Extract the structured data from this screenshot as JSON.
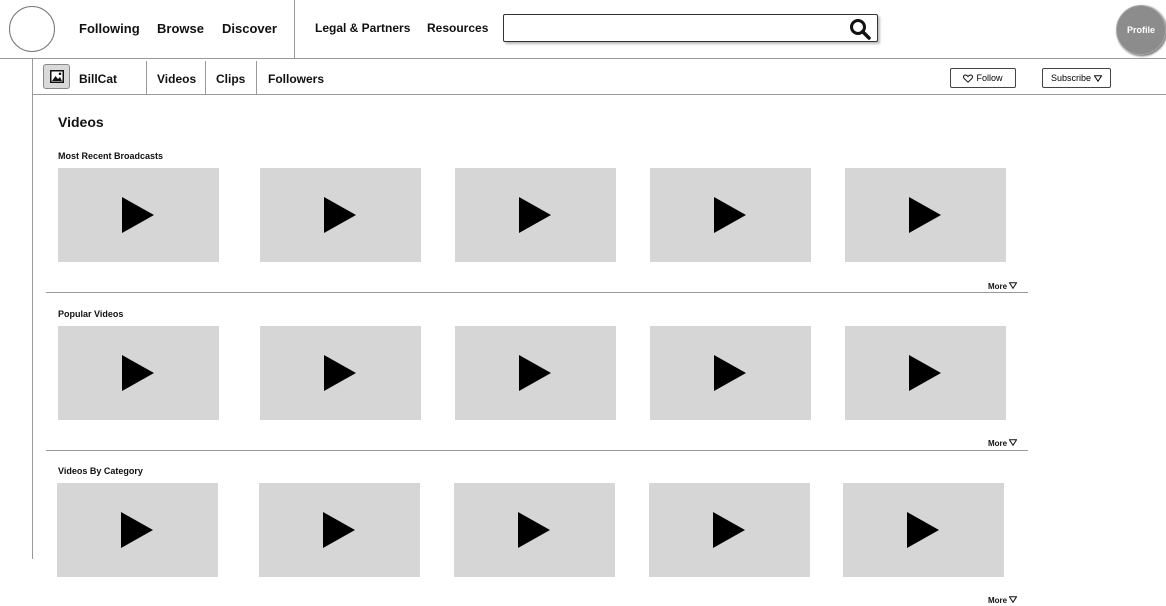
{
  "nav": {
    "items": [
      "Following",
      "Browse",
      "Discover",
      "Legal & Partners",
      "Resources"
    ]
  },
  "search": {
    "value": "",
    "placeholder": "",
    "icon": "search-icon"
  },
  "profile": {
    "label": "Profile"
  },
  "channel": {
    "avatar_icon": "image-icon",
    "name": "BillCat",
    "tabs": [
      "Videos",
      "Clips",
      "Followers"
    ],
    "follow_label": "Follow",
    "follow_icon": "heart-icon",
    "subscribe_label": "Subscribe",
    "subscribe_icon": "triangle-down-icon"
  },
  "page": {
    "title": "Videos"
  },
  "sections": [
    {
      "title": "Most Recent Broadcasts",
      "video_count": 5,
      "more_label": "More"
    },
    {
      "title": "Popular Videos",
      "video_count": 5,
      "more_label": "More"
    },
    {
      "title": "Videos By Category",
      "video_count": 5,
      "more_label": "More"
    }
  ],
  "colors": {
    "thumbnail": "#d6d6d6",
    "profile": "#8c8c8c",
    "divider": "#999999"
  }
}
